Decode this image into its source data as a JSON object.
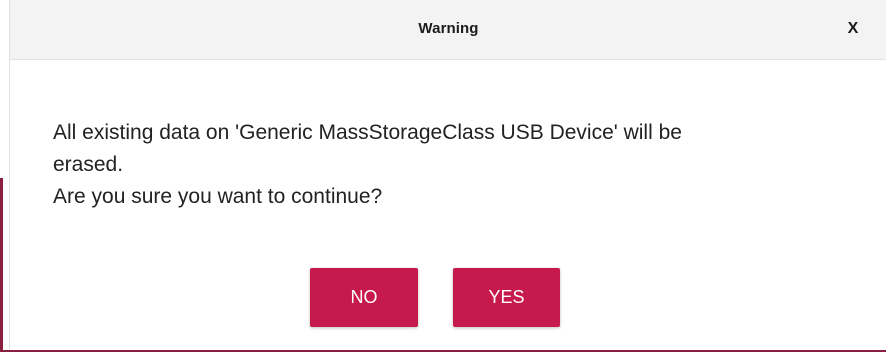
{
  "dialog": {
    "title": "Warning",
    "close_label": "X",
    "message_lines": [
      "All existing data on 'Generic MassStorageClass USB Device' will be",
      "erased.",
      "Are you sure you want to continue?"
    ],
    "buttons": {
      "no_label": "NO",
      "yes_label": "YES"
    }
  },
  "colors": {
    "button_background": "#c71a4c",
    "titlebar_background": "#f3f3f3",
    "backdrop_accent": "#8a2040"
  },
  "icons": {
    "close": "close-icon"
  }
}
